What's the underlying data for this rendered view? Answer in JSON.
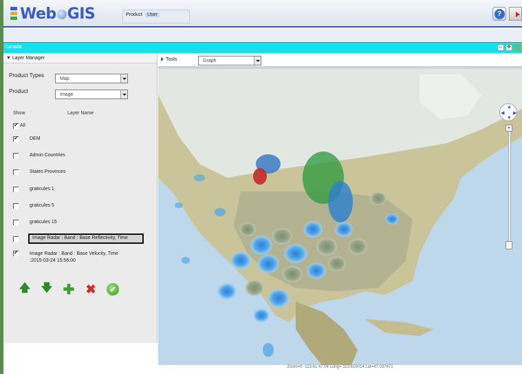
{
  "app": {
    "logo_web": "Web",
    "logo_gis": "GIS",
    "product_label": "Product",
    "user_label": "User",
    "help_icon": "help-icon",
    "exit_icon": "exit-icon"
  },
  "map_title": "Canada",
  "layer_manager": {
    "title": "Layer Manager",
    "product_types_label": "Product Types",
    "product_types_value": "Map",
    "product_label": "Product",
    "product_value": "Image",
    "col_show": "Show",
    "col_layer_name": "Layer Name",
    "all_label": "All",
    "layers": [
      {
        "name": "DEM",
        "checked": true
      },
      {
        "name": "Admin Countries",
        "checked": false
      },
      {
        "name": "States Provinces",
        "checked": false
      },
      {
        "name": "graticules 1",
        "checked": false
      },
      {
        "name": "graticules 5",
        "checked": false
      },
      {
        "name": "graticules 15",
        "checked": false
      },
      {
        "name": "Image Radar : Band : Base Reflectivity, Time",
        "checked": false,
        "selected": true
      },
      {
        "name": "Image Radar : Band : Base Velocity, Time",
        "line2": ":2015-03-24 15:56:00",
        "checked": true
      }
    ],
    "buttons": {
      "up": "arrow-up-icon",
      "down": "arrow-down-icon",
      "add": "plus-icon",
      "delete": "delete-icon",
      "apply": "check-icon"
    }
  },
  "tools": {
    "label": "Tools",
    "graph_select": "Graph"
  },
  "status_text": "Zoom=0 -113.61 47.04 Long=-113.619014 Lat=47.037671"
}
